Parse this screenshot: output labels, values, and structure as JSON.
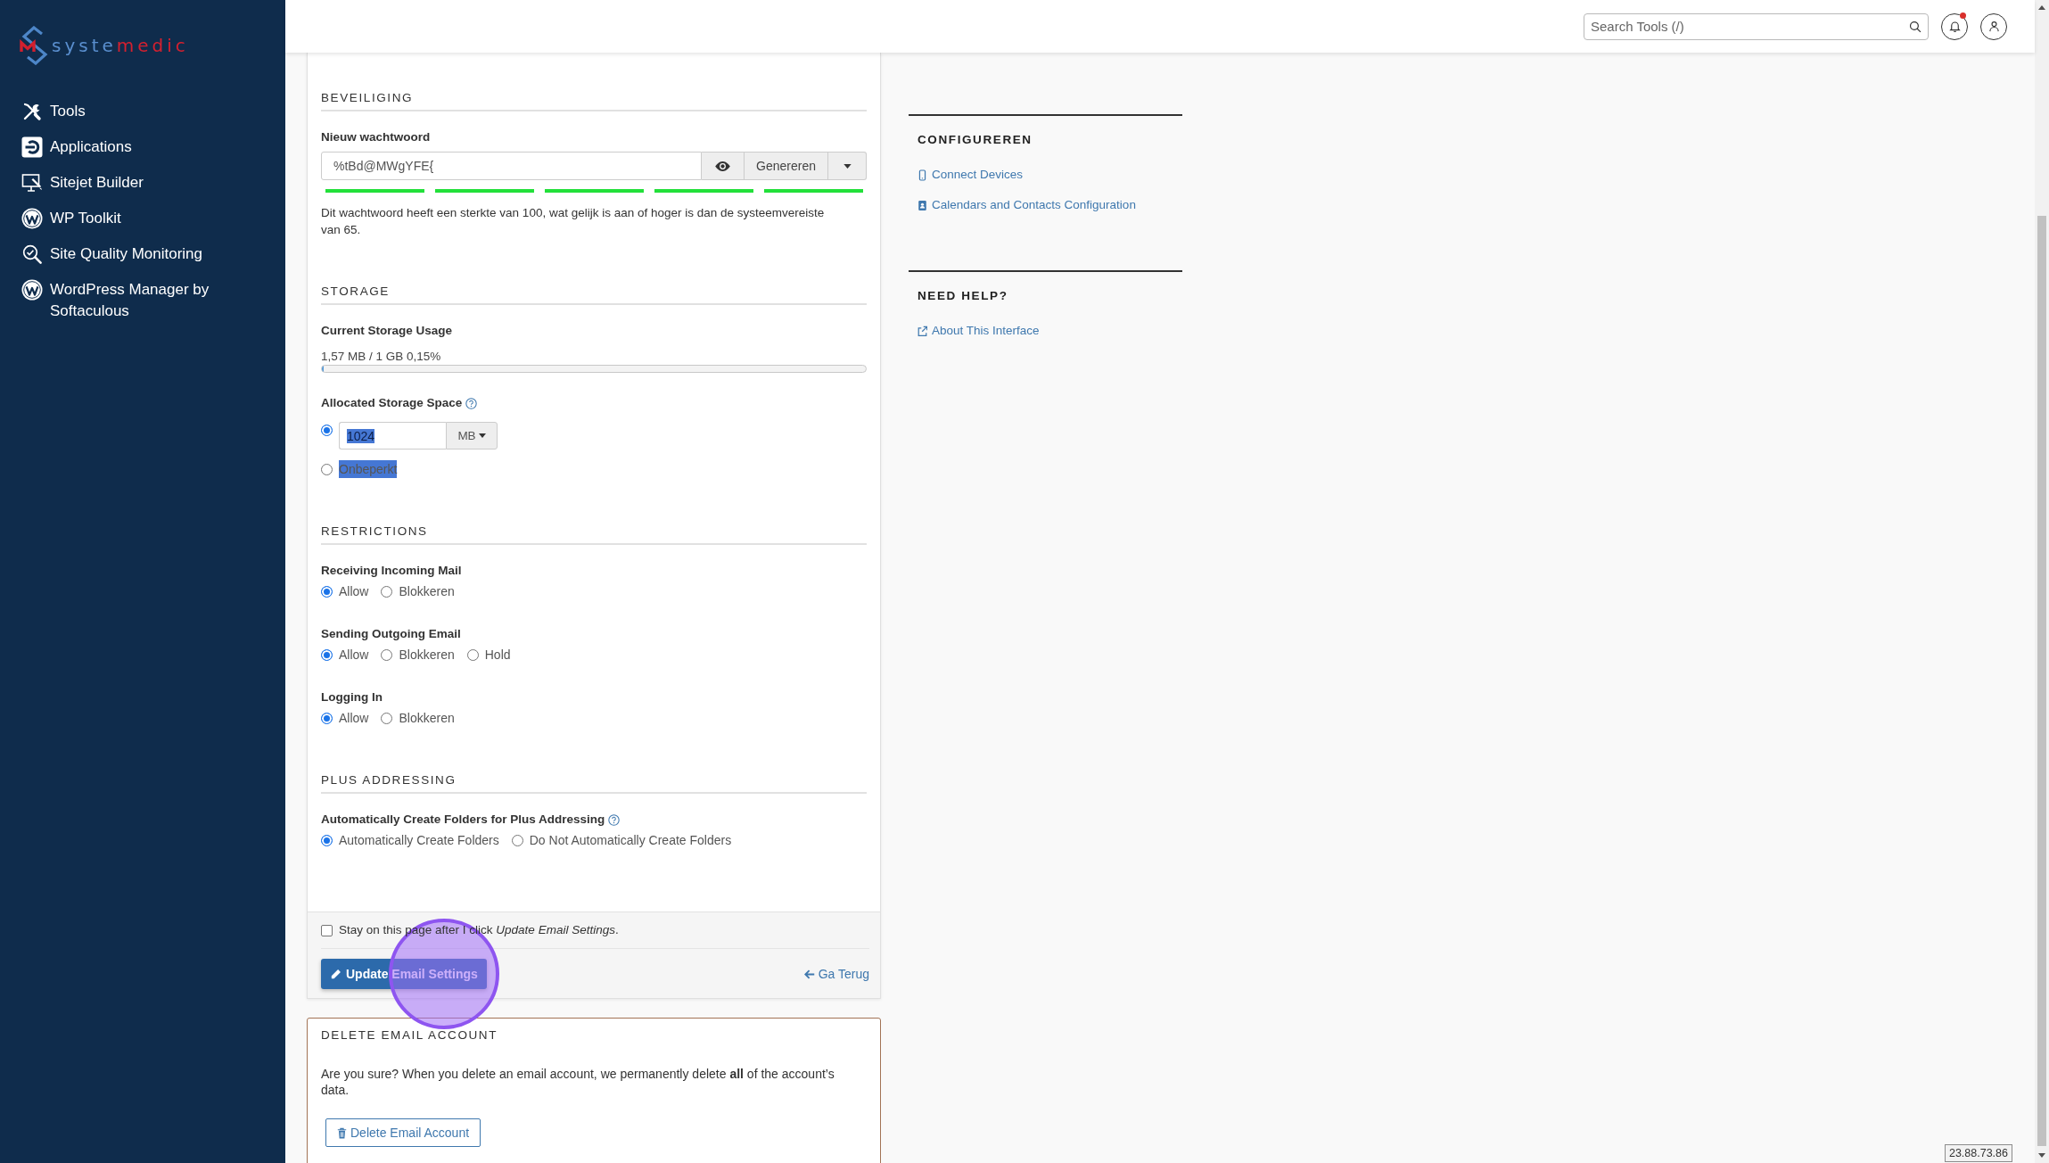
{
  "sidebar": {
    "logo": {
      "first_part": "syste",
      "second_part": "medic"
    },
    "items": [
      "Tools",
      "Applications",
      "Sitejet Builder",
      "WP Toolkit",
      "Site Quality Monitoring",
      "WordPress Manager by Softaculous"
    ]
  },
  "topbar": {
    "search": {
      "placeholder": "Search Tools (/)"
    },
    "notifications": {
      "unread": true
    }
  },
  "security": {
    "heading": "BEVEILIGING",
    "password_label": "Nieuw wachtwoord",
    "password_value": "%tBd@MWgYFE{",
    "generate_button": "Genereren",
    "strength": {
      "level": 1
    },
    "strength_note": "Dit wachtwoord heeft een sterkte van 100, wat gelijk is aan of hoger is dan de systeemvereiste van 65."
  },
  "storage": {
    "heading": "STORAGE",
    "usage_label": "Current Storage Usage",
    "usage_reading": "1,57 MB / 1 GB 0,15%",
    "usage_meter": {
      "level": 0.0015
    },
    "allocated_label": "Allocated Storage Space",
    "options": [
      {
        "kind": "quota",
        "selected": true,
        "value": "1024",
        "highlighted": true,
        "unit": "MB"
      },
      {
        "kind": "unlimited",
        "selected": false,
        "label": "Onbeperkt",
        "highlighted": true
      }
    ]
  },
  "restrictions": {
    "heading": "RESTRICTIONS",
    "groups": [
      {
        "label": "Receiving Incoming Mail",
        "options": [
          {
            "label": "Allow",
            "selected": true
          },
          {
            "label": "Blokkeren",
            "selected": false
          }
        ]
      },
      {
        "label": "Sending Outgoing Email",
        "options": [
          {
            "label": "Allow",
            "selected": true
          },
          {
            "label": "Blokkeren",
            "selected": false
          },
          {
            "label": "Hold",
            "selected": false
          }
        ]
      },
      {
        "label": "Logging In",
        "options": [
          {
            "label": "Allow",
            "selected": true
          },
          {
            "label": "Blokkeren",
            "selected": false
          }
        ]
      }
    ]
  },
  "plus_addressing": {
    "heading": "PLUS ADDRESSING",
    "label": "Automatically Create Folders for Plus Addressing",
    "options": [
      {
        "label": "Automatically Create Folders",
        "selected": true
      },
      {
        "label": "Do Not Automatically Create Folders",
        "selected": false
      }
    ]
  },
  "form_footer": {
    "stay_on_page": {
      "checked": false,
      "label": "Stay on this page after I click *Update Email Settings*."
    },
    "submit_button": "Update Email Settings",
    "back_link": "Ga Terug"
  },
  "delete_account": {
    "heading": "DELETE EMAIL ACCOUNT",
    "warning": "Are you sure? When you delete an email account, we permanently delete **all** of the account’s data.",
    "button": "Delete Email Account"
  },
  "right_panel": {
    "sections": [
      {
        "heading": "CONFIGUREREN",
        "links": [
          "Connect Devices",
          "Calendars and Contacts Configuration"
        ]
      },
      {
        "heading": "NEED HELP?",
        "links": [
          "About This Interface"
        ]
      }
    ]
  },
  "ip_badge": "23.88.73.86"
}
